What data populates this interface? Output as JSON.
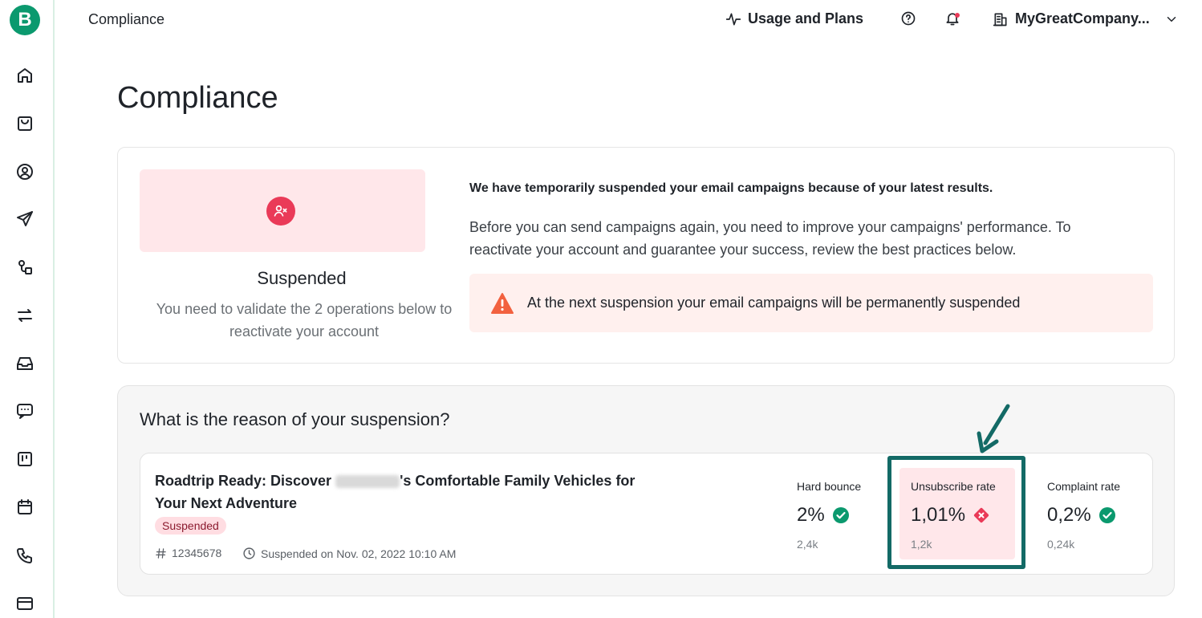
{
  "brand": {
    "logo_letter": "B",
    "color": "#0b996e"
  },
  "sidebar": {
    "items": [
      {
        "name": "home-icon"
      },
      {
        "name": "shopping-bag-icon"
      },
      {
        "name": "user-circle-icon"
      },
      {
        "name": "send-icon"
      },
      {
        "name": "automation-icon"
      },
      {
        "name": "transfer-icon"
      },
      {
        "name": "inbox-icon"
      },
      {
        "name": "chat-icon"
      },
      {
        "name": "board-icon"
      },
      {
        "name": "calendar-icon"
      },
      {
        "name": "phone-icon"
      },
      {
        "name": "card-icon"
      }
    ]
  },
  "header": {
    "title": "Compliance",
    "usage_label": "Usage and Plans",
    "account_label": "MyGreatCompany..."
  },
  "page": {
    "title": "Compliance"
  },
  "status": {
    "title": "Suspended",
    "description": "You need to validate the 2 operations below to reactivate your account"
  },
  "notice": {
    "headline": "We have temporarily suspended your email campaigns because of your latest results.",
    "body": "Before you can send campaigns again, you need to improve your campaigns' performance. To reactivate your account and guarantee your success, review the best practices below.",
    "warning": "At the next suspension your email campaigns will be permanently suspended"
  },
  "reason": {
    "title": "What is the reason of your suspension?",
    "campaign": {
      "name_start": "Roadtrip Ready: Discover ",
      "name_end": "'s Comfortable Family Vehicles for Your Next Adventure",
      "badge": "Suspended",
      "id": "12345678",
      "date": "Suspended on Nov. 02, 2022 10:10 AM"
    },
    "metrics": [
      {
        "label": "Hard bounce",
        "value": "2%",
        "sub": "2,4k",
        "status": "ok"
      },
      {
        "label": "Unsubscribe rate",
        "value": "1,01%",
        "sub": "1,2k",
        "status": "fail"
      },
      {
        "label": "Complaint rate",
        "value": "0,2%",
        "sub": "0,24k",
        "status": "ok"
      }
    ]
  },
  "colors": {
    "ok": "#0b996e",
    "fail": "#ea3a58",
    "warning": "#f2613f",
    "annotation": "#136a66"
  }
}
